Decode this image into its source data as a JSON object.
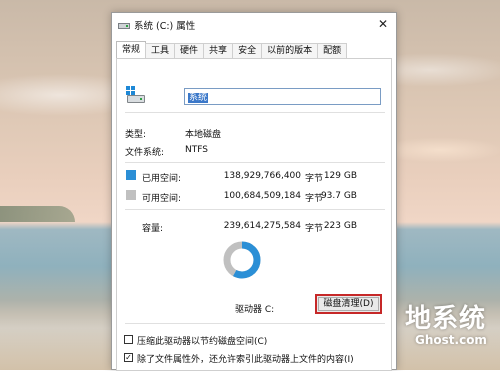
{
  "window": {
    "title": "系统 (C:) 属性",
    "close_glyph": "✕"
  },
  "tabs": [
    "常规",
    "工具",
    "硬件",
    "共享",
    "安全",
    "以前的版本",
    "配额"
  ],
  "general": {
    "drive_name": "系统",
    "type_label": "类型:",
    "type_value": "本地磁盘",
    "fs_label": "文件系统:",
    "fs_value": "NTFS",
    "used": {
      "label": "已用空间:",
      "bytes": "138,929,766,400",
      "unit": "字节",
      "size": "129 GB",
      "color": "#2b8fd6"
    },
    "free": {
      "label": "可用空间:",
      "bytes": "100,684,509,184",
      "unit": "字节",
      "size": "93.7 GB",
      "color": "#c0c0c0"
    },
    "capacity": {
      "label": "容量:",
      "bytes": "239,614,275,584",
      "unit": "字节",
      "size": "223 GB"
    },
    "used_fraction": 0.58,
    "drive_label": "驱动器 C:",
    "cleanup_button": "磁盘清理(D)",
    "compress_label": "压缩此驱动器以节约磁盘空间(C)",
    "compress_checked": false,
    "index_label": "除了文件属性外，还允许索引此驱动器上文件的内容(I)",
    "index_checked": true
  },
  "watermark": {
    "cn": "地系统",
    "en": "Ghost.com"
  }
}
